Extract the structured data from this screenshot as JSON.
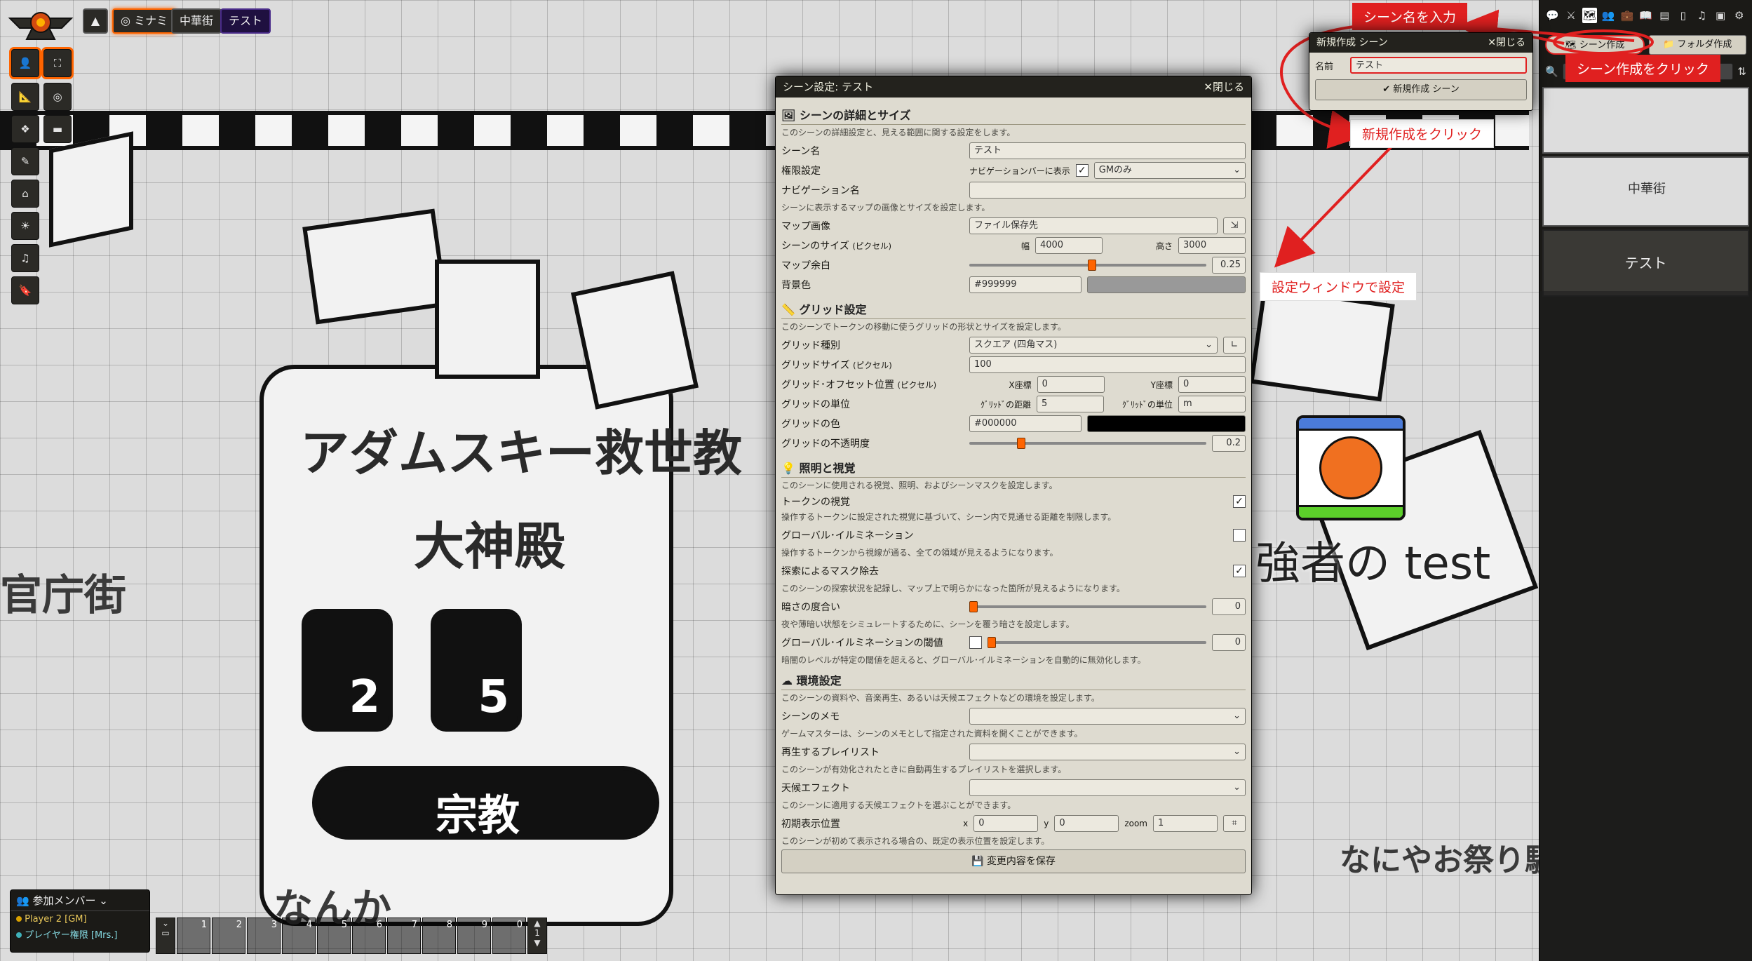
{
  "scene_nav": {
    "up_icon": "caret-up-icon",
    "scene_minami": "ミナミ",
    "scene_chuka": "中華街",
    "scene_test": "テスト"
  },
  "map": {
    "sign_line1": "アダムスキー救世教",
    "sign_line2": "大神殿",
    "stat_a": "2",
    "stat_b": "5",
    "religion_label": "宗教",
    "left_text": "官庁街",
    "bottom_text": "なんか",
    "bottom_right_text": "なにやお祭り騒ぎがあると",
    "token_name": "強者の test"
  },
  "new_scene_window": {
    "title": "新規作成 シーン",
    "close_label": "閉じる",
    "name_label": "名前",
    "name_value": "テスト",
    "create_button": "新規作成 シーン"
  },
  "sidebar": {
    "tabs": [
      "chat-icon",
      "combat-icon",
      "scenes-icon",
      "actors-icon",
      "items-icon",
      "journal-icon",
      "tables-icon",
      "cards-icon",
      "playlists-icon",
      "compendium-icon",
      "settings-icon"
    ],
    "create_scene": "シーン作成",
    "create_folder": "フォルダ作成",
    "scene_list": [
      "",
      "中華街",
      "テスト"
    ]
  },
  "scene_config": {
    "title": "シーン設定: テスト",
    "close_label": "閉じる",
    "section_basic": "シーンの詳細とサイズ",
    "basic_hint": "このシーンの詳細設定と、見える範囲に関する設定をします。",
    "scene_name_label": "シーン名",
    "scene_name_value": "テスト",
    "permission_label": "権限設定",
    "navbar_label": "ナビゲーションバーに表示",
    "permission_value": "GMのみ",
    "nav_name_label": "ナビゲーション名",
    "nav_name_value": "",
    "map_hint": "シーンに表示するマップの画像とサイズを設定します。",
    "map_image_label": "マップ画像",
    "map_image_value": "ファイル保存先",
    "scene_size_label": "シーンのサイズ",
    "scene_size_unit": "(ピクセル)",
    "width_label": "幅",
    "width_value": "4000",
    "height_label": "高さ",
    "height_value": "3000",
    "padding_label": "マップ余白",
    "padding_value": "0.25",
    "bgcolor_label": "背景色",
    "bgcolor_value": "#999999",
    "section_grid": "グリッド設定",
    "grid_hint": "このシーンでトークンの移動に使うグリッドの形状とサイズを設定します。",
    "grid_type_label": "グリッド種別",
    "grid_type_value": "スクエア (四角マス)",
    "grid_size_label": "グリッドサイズ",
    "grid_size_unit": "(ピクセル)",
    "grid_size_value": "100",
    "grid_offset_label": "グリッド･オフセット位置",
    "grid_offset_unit": "(ピクセル)",
    "x_offset_label": "X座標",
    "x_offset_value": "0",
    "y_offset_label": "Y座標",
    "y_offset_value": "0",
    "grid_unit_label": "グリッドの単位",
    "grid_distance_label": "ｸﾞﾘｯﾄﾞの距離",
    "grid_distance_value": "5",
    "grid_units_label": "ｸﾞﾘｯﾄﾞの単位",
    "grid_units_value": "m",
    "grid_color_label": "グリッドの色",
    "grid_color_value": "#000000",
    "grid_alpha_label": "グリッドの不透明度",
    "grid_alpha_value": "0.2",
    "section_vision": "照明と視覚",
    "vision_hint": "このシーンに使用される視覚、照明、およびシーンマスクを設定します。",
    "token_vision_label": "トークンの視覚",
    "token_vision_hint": "操作するトークンに設定された視覚に基づいて、シーン内で見通せる距離を制限します。",
    "global_illum_label": "グローバル･イルミネーション",
    "global_illum_hint": "操作するトークンから視線が通る、全ての領域が見えるようになります。",
    "fog_label": "探索によるマスク除去",
    "fog_hint": "このシーンの探索状況を記録し、マップ上で明らかになった箇所が見えるようになります。",
    "darkness_label": "暗さの度合い",
    "darkness_value": "0",
    "darkness_hint": "夜や薄暗い状態をシミュレートするために、シーンを覆う暗さを設定します。",
    "illum_threshold_label": "グローバル･イルミネーションの閾値",
    "illum_threshold_value": "0",
    "illum_threshold_hint": "暗闇のレベルが特定の閾値を超えると、グローバル･イルミネーションを自動的に無効化します。",
    "section_env": "環境設定",
    "env_hint": "このシーンの資料や、音楽再生、あるいは天候エフェクトなどの環境を設定します。",
    "memo_label": "シーンのメモ",
    "memo_hint": "ゲームマスターは、シーンのメモとして指定された資料を開くことができます。",
    "playlist_label": "再生するプレイリスト",
    "playlist_hint": "このシーンが有効化されたときに自動再生するプレイリストを選択します。",
    "weather_label": "天候エフェクト",
    "weather_hint": "このシーンに適用する天候エフェクトを選ぶことができます。",
    "initial_label": "初期表示位置",
    "x_label": "x",
    "x_value": "0",
    "y_label": "y",
    "y_value": "0",
    "zoom_label": "zoom",
    "zoom_value": "1",
    "initial_hint": "このシーンが初めて表示される場合の、既定の表示位置を設定します。",
    "save_button": "変更内容を保存"
  },
  "players": {
    "header": "参加メンバー",
    "player1": "Player 2 [GM]",
    "player2": "プレイヤー権限 [Mrs.]"
  },
  "hotbar": {
    "slots": [
      "1",
      "2",
      "3",
      "4",
      "5",
      "6",
      "7",
      "8",
      "9",
      "0"
    ],
    "page": "1"
  },
  "annotations": {
    "enter_name": "シーン名を入力",
    "click_create_scene": "シーン作成をクリック",
    "click_new": "新規作成をクリック",
    "configure": "設定ウィンドウで設定"
  },
  "colors": {
    "accent": "#ff6400",
    "annotation": "#e02020"
  }
}
